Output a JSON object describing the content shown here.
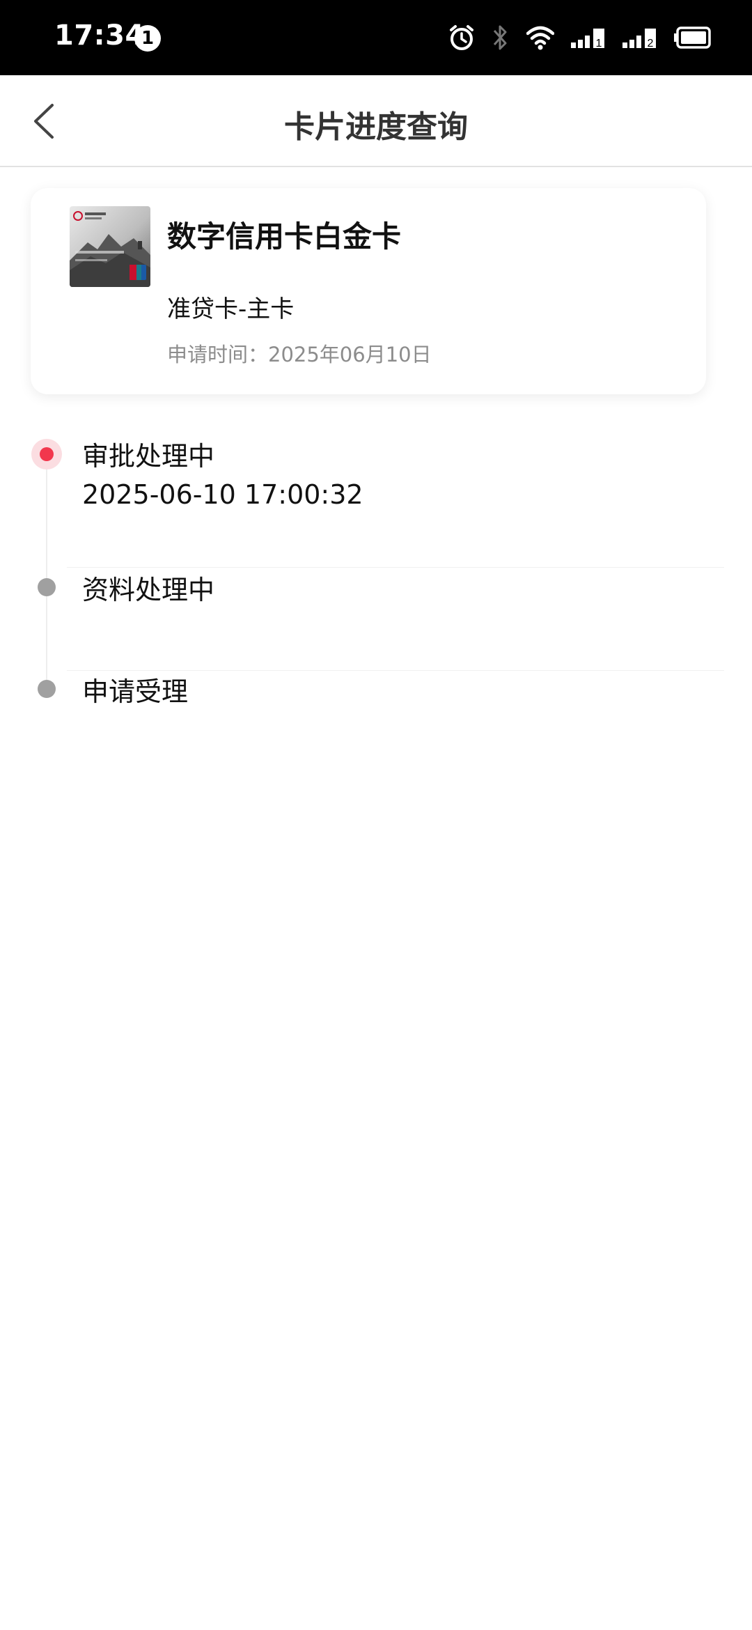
{
  "status_bar": {
    "time": "17:34",
    "notification_count": "1",
    "icons": [
      "alarm-icon",
      "bluetooth-icon",
      "wifi-icon",
      "signal-1-icon",
      "signal-2-icon",
      "battery-icon"
    ]
  },
  "nav": {
    "title": "卡片进度查询",
    "back_icon": "chevron-left-icon"
  },
  "card": {
    "name": "数字信用卡白金卡",
    "type": "准贷卡-主卡",
    "apply_date": "申请时间：2025年06月10日"
  },
  "timeline": {
    "steps": [
      {
        "title": "审批处理中",
        "time": "2025-06-10 17:00:32",
        "status": "active"
      },
      {
        "title": "资料处理中",
        "status": "pending"
      },
      {
        "title": "申请受理",
        "status": "pending"
      }
    ]
  },
  "colors": {
    "active": "#f2374d",
    "inactive": "#a0a0a0",
    "secondary_text": "#8c8c8c"
  }
}
